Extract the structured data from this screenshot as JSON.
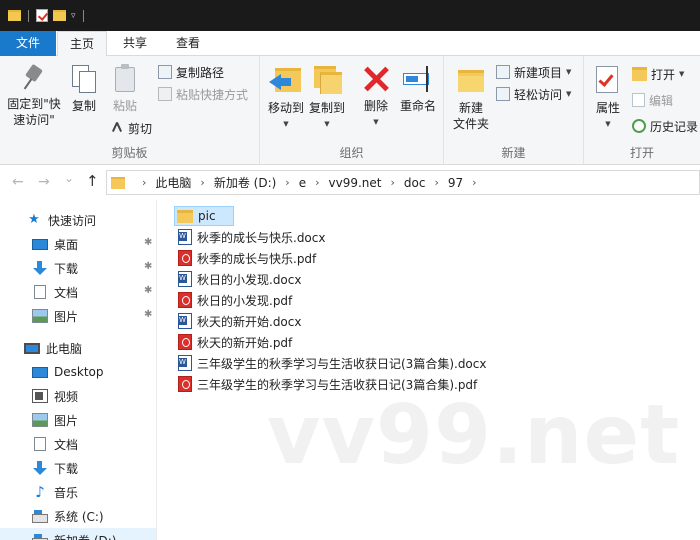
{
  "titlebar": {
    "icons": [
      "folder-icon",
      "properties-icon",
      "new-folder-icon",
      "chevron-down-icon"
    ]
  },
  "tabs": {
    "file": "文件",
    "home": "主页",
    "share": "共享",
    "view": "查看"
  },
  "ribbon": {
    "clipboard": {
      "label": "剪贴板",
      "pin_line1": "固定到\"快",
      "pin_line2": "速访问\"",
      "copy": "复制",
      "paste": "粘贴",
      "copy_path": "复制路径",
      "paste_shortcut": "粘贴快捷方式",
      "cut": "剪切"
    },
    "organize": {
      "label": "组织",
      "move_to": "移动到",
      "copy_to": "复制到",
      "delete": "删除",
      "rename": "重命名"
    },
    "new": {
      "label": "新建",
      "new_folder_line1": "新建",
      "new_folder_line2": "文件夹",
      "new_item": "新建项目",
      "easy_access": "轻松访问"
    },
    "open": {
      "label": "打开",
      "properties": "属性",
      "open": "打开",
      "edit": "编辑",
      "history": "历史记录"
    }
  },
  "address": {
    "back": "←",
    "forward": "→",
    "recent": "⌄",
    "up": "↑",
    "crumbs": [
      "此电脑",
      "新加卷 (D:)",
      "e",
      "vv99.net",
      "doc",
      "97"
    ],
    "separator": "›"
  },
  "navpane": {
    "items": [
      {
        "label": "快速访问",
        "icon": "star-icon"
      },
      {
        "label": "桌面",
        "icon": "desktop-icon",
        "pinned": true
      },
      {
        "label": "下载",
        "icon": "download-icon",
        "pinned": true
      },
      {
        "label": "文档",
        "icon": "document-icon",
        "pinned": true
      },
      {
        "label": "图片",
        "icon": "picture-icon",
        "pinned": true
      },
      {
        "label": "此电脑",
        "icon": "computer-icon"
      },
      {
        "label": "Desktop",
        "icon": "desktop-icon"
      },
      {
        "label": "视频",
        "icon": "video-icon"
      },
      {
        "label": "图片",
        "icon": "picture-icon"
      },
      {
        "label": "文档",
        "icon": "document-icon"
      },
      {
        "label": "下载",
        "icon": "download-icon"
      },
      {
        "label": "音乐",
        "icon": "music-icon"
      },
      {
        "label": "系统 (C:)",
        "icon": "drive-icon"
      },
      {
        "label": "新加卷 (D:)",
        "icon": "drive-icon"
      }
    ]
  },
  "files": [
    {
      "name": "pic",
      "type": "folder"
    },
    {
      "name": "秋季的成长与快乐.docx",
      "type": "docx"
    },
    {
      "name": "秋季的成长与快乐.pdf",
      "type": "pdf"
    },
    {
      "name": "秋日的小发现.docx",
      "type": "docx"
    },
    {
      "name": "秋日的小发现.pdf",
      "type": "pdf"
    },
    {
      "name": "秋天的新开始.docx",
      "type": "docx"
    },
    {
      "name": "秋天的新开始.pdf",
      "type": "pdf"
    },
    {
      "name": "三年级学生的秋季学习与生活收获日记(3篇合集).docx",
      "type": "docx"
    },
    {
      "name": "三年级学生的秋季学习与生活收获日记(3篇合集).pdf",
      "type": "pdf"
    }
  ],
  "watermark": "vv99.net",
  "colors": {
    "accent": "#1979ca",
    "selection": "#cce8ff",
    "delete_red": "#e0272b",
    "folder_yellow": "#f4c859"
  }
}
